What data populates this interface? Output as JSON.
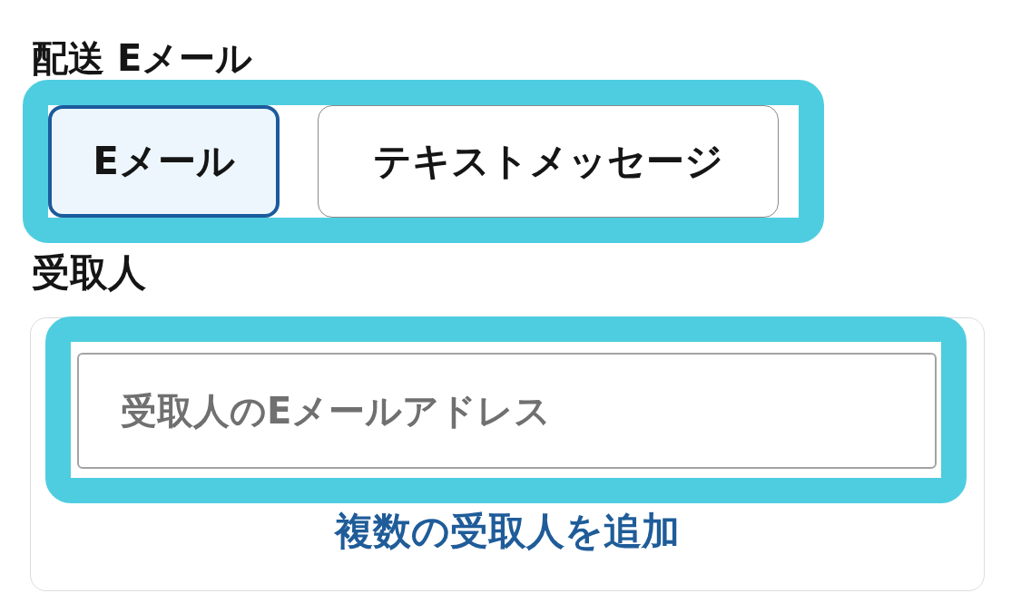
{
  "delivery": {
    "label": "配送 Eメール",
    "highlighted": true,
    "options": [
      {
        "label": "Eメール",
        "selected": true
      },
      {
        "label": "テキストメッセージ",
        "selected": false
      }
    ]
  },
  "recipients": {
    "label": "受取人",
    "input": {
      "placeholder": "受取人のEメールアドレス",
      "highlighted": true
    },
    "add_link": "複数の受取人を追加"
  }
}
